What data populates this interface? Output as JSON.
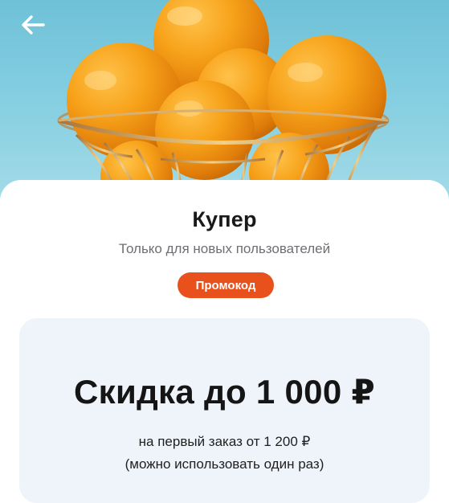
{
  "header": {
    "back_icon": "arrow-left-icon",
    "hero_image": "oranges-in-wire-basket"
  },
  "store": {
    "name": "Купер",
    "audience": "Только для новых пользователей",
    "badge": "Промокод",
    "badge_color": "#e8511c"
  },
  "offer": {
    "title": "Скидка до 1 000 ₽",
    "condition": "на первый заказ от 1 200 ₽",
    "note": "(можно использовать один раз)"
  }
}
